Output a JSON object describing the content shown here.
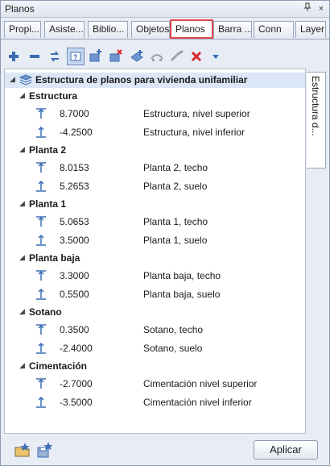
{
  "window": {
    "title": "Planos",
    "pin_symbol": "p",
    "close_symbol": "×"
  },
  "tabs": [
    {
      "label": "Propi..."
    },
    {
      "label": "Asiste..."
    },
    {
      "label": "Biblio..."
    },
    {
      "label": "Objetos"
    },
    {
      "label": "Planos",
      "active": true
    },
    {
      "label": "Barra ..."
    },
    {
      "label": "Conn"
    },
    {
      "label": "Layer"
    }
  ],
  "toolbar": {
    "icons": [
      "add-icon",
      "remove-icon",
      "swap-icon",
      "level-mode-icon",
      "add-plan-icon",
      "delete-plan-icon",
      "add-level-icon",
      "hide-icon",
      "link-icon",
      "delete-icon",
      "dropdown-icon"
    ]
  },
  "side_tab": {
    "label": "Estructura d..."
  },
  "tree": {
    "root_label": "Estructura de planos para vivienda unifamiliar",
    "groups": [
      {
        "label": "Estructura",
        "rows": [
          {
            "value": "8.7000",
            "desc": "Estructura, nivel superior",
            "kind": "top"
          },
          {
            "value": "-4.2500",
            "desc": "Estructura, nivel inferior",
            "kind": "bottom"
          }
        ]
      },
      {
        "label": "Planta 2",
        "rows": [
          {
            "value": "8.0153",
            "desc": "Planta 2, techo",
            "kind": "top"
          },
          {
            "value": "5.2653",
            "desc": "Planta 2, suelo",
            "kind": "bottom"
          }
        ]
      },
      {
        "label": "Planta 1",
        "rows": [
          {
            "value": "5.0653",
            "desc": "Planta 1, techo",
            "kind": "top"
          },
          {
            "value": "3.5000",
            "desc": "Planta 1, suelo",
            "kind": "bottom"
          }
        ]
      },
      {
        "label": "Planta baja",
        "rows": [
          {
            "value": "3.3000",
            "desc": "Planta baja, techo",
            "kind": "top"
          },
          {
            "value": "0.5500",
            "desc": "Planta baja, suelo",
            "kind": "bottom"
          }
        ]
      },
      {
        "label": "Sotano",
        "rows": [
          {
            "value": "0.3500",
            "desc": "Sotano, techo",
            "kind": "top"
          },
          {
            "value": "-2.4000",
            "desc": "Sotano, suelo",
            "kind": "bottom"
          }
        ]
      },
      {
        "label": "Cimentación",
        "rows": [
          {
            "value": "-2.7000",
            "desc": "Cimentación nivel superior",
            "kind": "top"
          },
          {
            "value": "-3.5000",
            "desc": "Cimentación nivel inferior",
            "kind": "bottom"
          }
        ]
      }
    ]
  },
  "footer": {
    "apply_label": "Aplicar"
  },
  "colors": {
    "accent": "#e0474c",
    "selection": "#dbe6f6",
    "icon_blue": "#3b6db3",
    "delete_red": "#d9262c"
  }
}
